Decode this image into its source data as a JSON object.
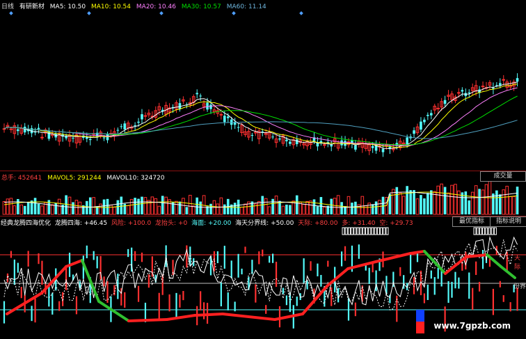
{
  "price_header": {
    "period": "日线",
    "stock_name": "有研新材",
    "ma5": "MA5: 10.50",
    "ma10": "MA10: 10.54",
    "ma20": "MA20: 10.46",
    "ma30": "MA30: 10.57",
    "ma60": "MA60: 11.14"
  },
  "volume_header": {
    "total_label": "总手: 452641",
    "mavol5": "MAVOL5: 291244",
    "mavol10": "MAVOL10: 324720",
    "button": "成交量"
  },
  "indicator_header": {
    "name": "经典龙腾四海优化",
    "dragon": "龙腾四海: +46.45",
    "risk": "风险: +100.0",
    "peak": "龙抬头: +0",
    "sea": "海面: +20.00",
    "divide": "海天分界线: +50.00",
    "sky": "天际: +80.00",
    "bull": "多: +31.40",
    "bear": "空: +29.73",
    "btn_best": "最优指标",
    "btn_help": "指标说明"
  },
  "indicator_labels": {
    "right_top": "天际",
    "right_bottom": "份界"
  },
  "watermark": "www.7gpzb.com",
  "colors": {
    "up": "#ff3030",
    "down": "#54fcfc",
    "ma5": "#ffffff",
    "ma10": "#ffff00",
    "ma20": "#ff80ff",
    "ma30": "#00e000",
    "ma60": "#4f9fbf",
    "red_line": "#ff2020",
    "green_line": "#30c030"
  }
}
